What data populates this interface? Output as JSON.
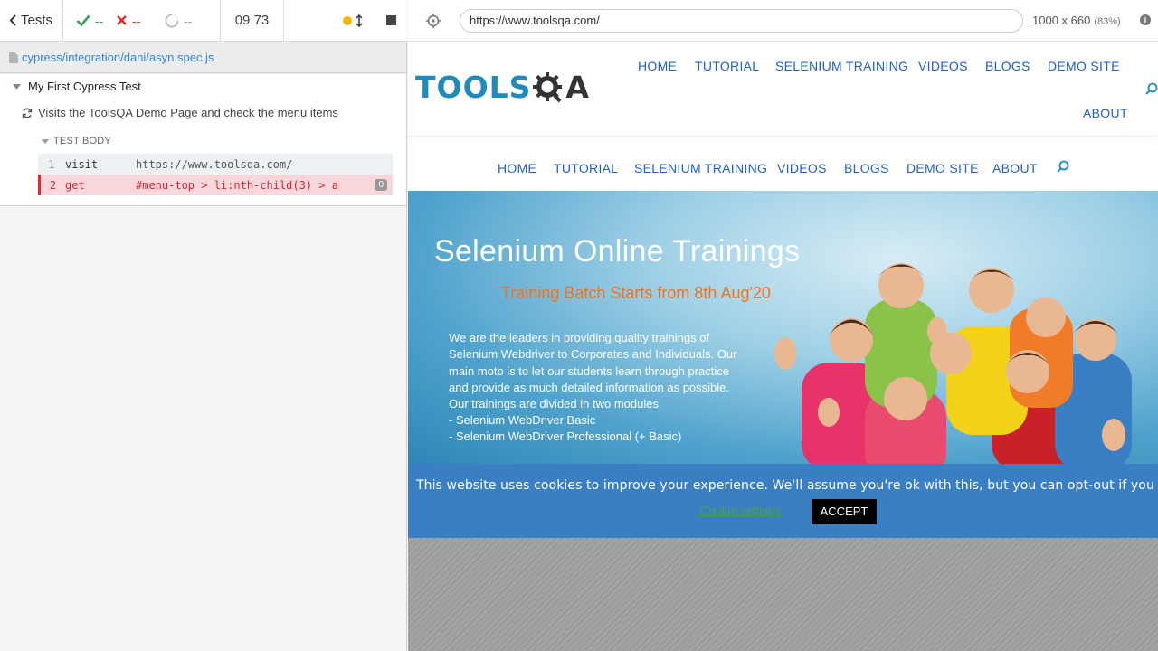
{
  "reporter": {
    "tests_label": "Tests",
    "passed": "--",
    "failed": "--",
    "pending": "--",
    "duration": "09.73",
    "spec_path": "cypress/integration/dani/asyn.spec.js",
    "suite_title": "My First Cypress Test",
    "test_title": "Visits the ToolsQA Demo Page and check the menu items",
    "test_body_label": "TEST BODY",
    "commands": [
      {
        "num": "1",
        "name": "visit",
        "message": "https://www.toolsqa.com/",
        "state": "passed"
      },
      {
        "num": "2",
        "name": "get",
        "message": "#menu-top > li:nth-child(3) > a",
        "count": "0",
        "state": "failed"
      }
    ],
    "colors": {
      "passed": "#3b9a5a",
      "failed": "#e0281e",
      "running": "#f8b500",
      "link": "#3386d4"
    }
  },
  "aut_header": {
    "url": "https://www.toolsqa.com/",
    "viewport": "1000 x 660",
    "scale": "(83%)"
  },
  "site": {
    "logo_left": "TOOLS",
    "logo_right": "A",
    "top_nav": [
      "HOME",
      "TUTORIAL",
      "SELENIUM TRAINING",
      "VIDEOS",
      "BLOGS",
      "DEMO SITE",
      "ABOUT"
    ],
    "nav2": [
      "HOME",
      "TUTORIAL",
      "SELENIUM TRAINING",
      "VIDEOS",
      "BLOGS",
      "DEMO SITE",
      "ABOUT"
    ],
    "hero": {
      "title": "Selenium Online Trainings",
      "subtitle": "Training Batch Starts from 8th Aug'20",
      "paragraph": "We are the leaders in providing quality trainings of Selenium Webdriver to Corporates and Individuals. Our main moto is to let our students learn through practice and provide as much detailed information as possible. Our trainings are divided in two modules",
      "list": [
        "- Selenium WebDriver Basic",
        "- Selenium WebDriver Professional (+ Basic)"
      ]
    },
    "cookie": {
      "text": "This website uses cookies to improve your experience. We'll assume you're ok with this, but you can opt-out if you wish.",
      "settings_label": "Cookie settings",
      "accept_label": "ACCEPT"
    },
    "colors": {
      "brand": "#1f8bbd",
      "nav": "#1f5fc9",
      "accent": "#f07320",
      "cookie_bg": "#3a7fc4"
    }
  }
}
